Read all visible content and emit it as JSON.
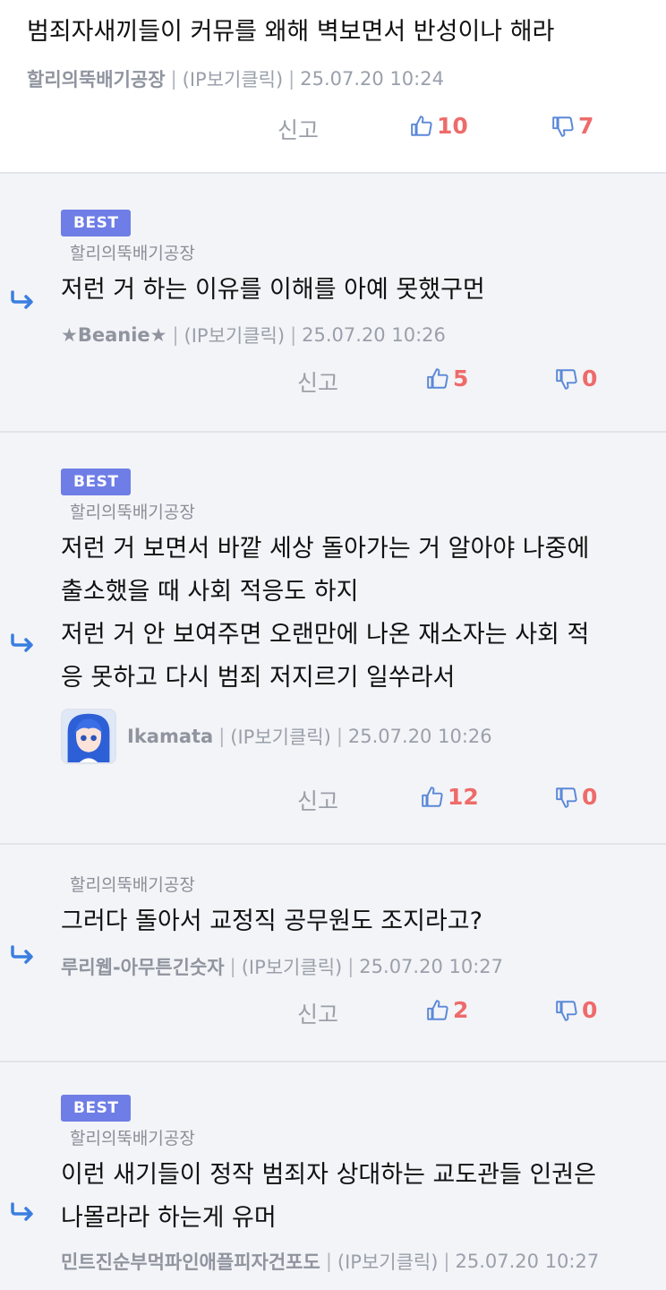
{
  "comments": [
    {
      "best": false,
      "badge": "",
      "parent": "",
      "text": "범죄자새끼들이 커뮤를 왜해 벽보면서 반성이나 해라",
      "author": "할리의뚝배기공장",
      "ip": "(IP보기클릭)",
      "date": "25.07.20 10:24",
      "report": "신고",
      "up": "10",
      "down": "7"
    },
    {
      "best": true,
      "badge": "BEST",
      "parent": "할리의뚝배기공장",
      "text": "저런 거 하는 이유를 이해를 아예 못했구먼",
      "author": "★Beanie★",
      "ip": "(IP보기클릭)",
      "date": "25.07.20 10:26",
      "report": "신고",
      "up": "5",
      "down": "0"
    },
    {
      "best": true,
      "badge": "BEST",
      "parent": "할리의뚝배기공장",
      "text_lines": [
        "저런 거 보면서 바깥 세상 돌아가는 거 알아야 나중에",
        "출소했을 때 사회 적응도 하지",
        "저런 거 안 보여주면 오랜만에 나온 재소자는 사회 적",
        "응 못하고 다시 범죄 저지르기 일쑤라서"
      ],
      "author": "Ikamata",
      "ip": "(IP보기클릭)",
      "date": "25.07.20 10:26",
      "report": "신고",
      "up": "12",
      "down": "0"
    },
    {
      "best": false,
      "badge": "",
      "parent": "할리의뚝배기공장",
      "text": "그러다 돌아서 교정직 공무원도 조지라고?",
      "author": "루리웹-아무튼긴숫자",
      "ip": "(IP보기클릭)",
      "date": "25.07.20 10:27",
      "report": "신고",
      "up": "2",
      "down": "0"
    },
    {
      "best": true,
      "badge": "BEST",
      "parent": "할리의뚝배기공장",
      "text_lines": [
        "이런 새기들이 정작 범죄자 상대하는 교도관들 인권은",
        "나몰라라 하는게 유머"
      ],
      "author": "민트진순부먹파인애플피자건포도",
      "ip": "(IP보기클릭)",
      "date": "25.07.20 10:27"
    }
  ],
  "colors": {
    "best_badge": "#6e7ee6",
    "up_icon": "#5a88d8",
    "count": "#ee6b6b",
    "reply_arrow": "#3a7ee0"
  },
  "icons": {
    "reply": "reply-arrow-icon",
    "up": "thumbs-up-icon",
    "down": "thumbs-down-icon"
  }
}
